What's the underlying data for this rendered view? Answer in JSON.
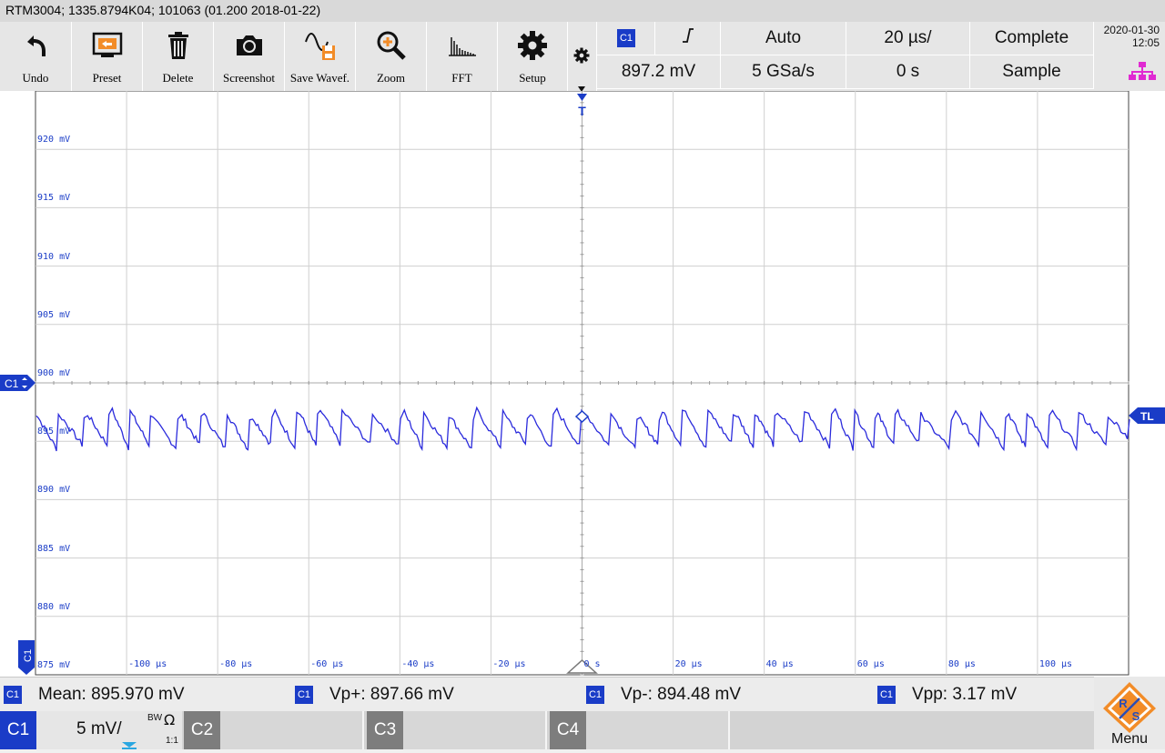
{
  "title": "RTM3004; 1335.8794K04; 101063 (01.200 2018-01-22)",
  "toolbar": {
    "undo": "Undo",
    "preset": "Preset",
    "delete": "Delete",
    "screenshot": "Screenshot",
    "save_waveform": "Save Wavef.",
    "zoom": "Zoom",
    "fft": "FFT",
    "setup": "Setup"
  },
  "acquisition": {
    "trigger_channel": "C1",
    "trigger_level": "897.2 mV",
    "trigger_mode": "Auto",
    "sample_rate": "5 GSa/s",
    "timebase": "20 µs/",
    "trigger_position": "0 s",
    "acq_status": "Complete",
    "acq_mode": "Sample"
  },
  "datetime": {
    "date": "2020-01-30",
    "time": "12:05"
  },
  "plot": {
    "y_labels": [
      "920 mV",
      "915 mV",
      "910 mV",
      "905 mV",
      "900 mV",
      "895 mV",
      "890 mV",
      "885 mV",
      "880 mV",
      "875 mV"
    ],
    "x_labels": [
      "-100 µs",
      "-80 µs",
      "-60 µs",
      "-40 µs",
      "-20 µs",
      "0 s",
      "20 µs",
      "40 µs",
      "60 µs",
      "80 µs",
      "100 µs"
    ],
    "channel_marker": "C1",
    "trigger_marker": "T",
    "trigger_level_marker": "TL",
    "waveform_color": "#2b2bdc",
    "grid_color": "#cfcfcf"
  },
  "measurements": [
    {
      "channel": "C1",
      "label": "Mean: 895.970 mV"
    },
    {
      "channel": "C1",
      "label": "Vp+: 897.66 mV"
    },
    {
      "channel": "C1",
      "label": "Vp-: 894.48 mV"
    },
    {
      "channel": "C1",
      "label": "Vpp: 3.17 mV"
    }
  ],
  "channels": {
    "c1": {
      "tag": "C1",
      "scale": "5 mV/",
      "coupling": "BW",
      "impedance": "Ω",
      "probe": "1:1"
    },
    "c2": {
      "tag": "C2"
    },
    "c3": {
      "tag": "C3"
    },
    "c4": {
      "tag": "C4"
    }
  },
  "menu": {
    "label": "Menu"
  },
  "colors": {
    "channel1": "#1a3cc7",
    "magenta": "#e02ad2",
    "orange": "#f28c28"
  }
}
